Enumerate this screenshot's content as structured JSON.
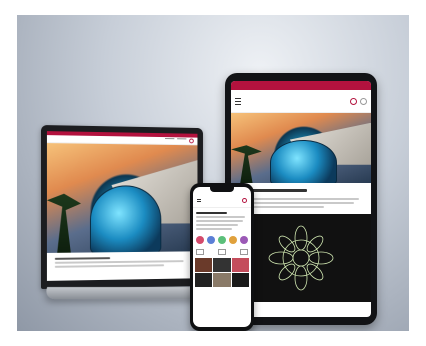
{
  "colors": {
    "brand": "#b3123e",
    "background": "#c7ced8",
    "device_frame": "#121316"
  },
  "icons": [
    "hamburger-menu-icon",
    "search-icon",
    "user-icon"
  ],
  "circles": [
    "#d44a6b",
    "#5b7fd6",
    "#5bbf7a",
    "#e0a13c",
    "#9b59b6"
  ]
}
